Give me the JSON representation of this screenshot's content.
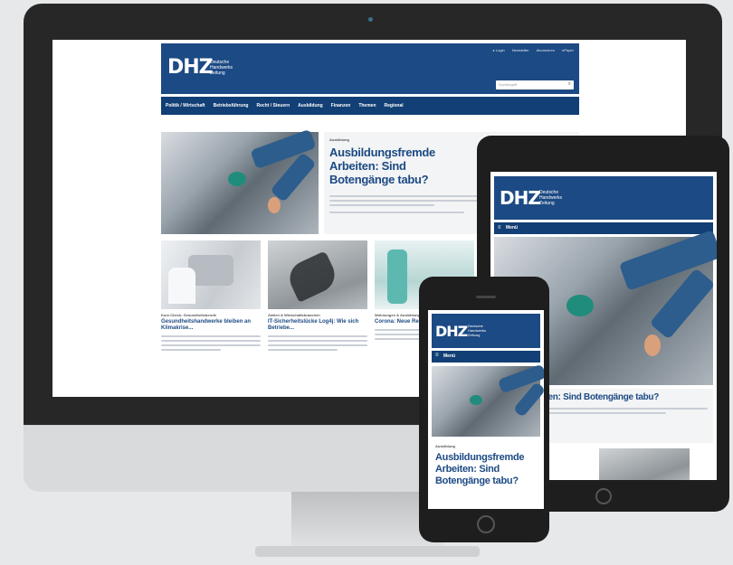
{
  "brand": {
    "logo": "DHZ",
    "subtitle_line1": "Deutsche",
    "subtitle_line2": "Handwerks",
    "subtitle_line3": "Zeitung"
  },
  "desktop": {
    "top_links": [
      "▸ Login",
      "Newsletter",
      "Abonnieren",
      "ePaper"
    ],
    "search_placeholder": "Suchbegriff",
    "nav": [
      "Politik / Wirtschaft",
      "Betriebsführung",
      "Recht / Steuern",
      "Ausbildung",
      "Finanzen",
      "Themen",
      "Regional"
    ],
    "hero": {
      "kicker": "Ausbildung",
      "headline": "Ausbildungsfremde Arbeiten: Sind Botengänge tabu?"
    },
    "cards": [
      {
        "kicker": "Kurz-Check: Gesundheitsberufe",
        "title": "Gesundheitshandwerke bleiben an Klimakrise..."
      },
      {
        "kicker": "Zahlen & Wirtschaftsbranchen",
        "title": "IT-Sicherheitslücke Log4j: Wie sich Betriebe..."
      },
      {
        "kicker": "Wohnungen & Ausbildung",
        "title": "Corona: Neue Regeln in..."
      }
    ]
  },
  "tablet": {
    "menu_label": "Menü",
    "headline": "...nde Arbeiten: Sind Botengänge tabu?"
  },
  "phone": {
    "menu_label": "Menü",
    "kicker": "Ausbildung",
    "headline": "Ausbildungsfremde Arbeiten: Sind Botengänge tabu?"
  },
  "colors": {
    "brand_blue": "#1c4a84",
    "nav_blue": "#123f75",
    "device_frame": "#1e1e1e"
  }
}
